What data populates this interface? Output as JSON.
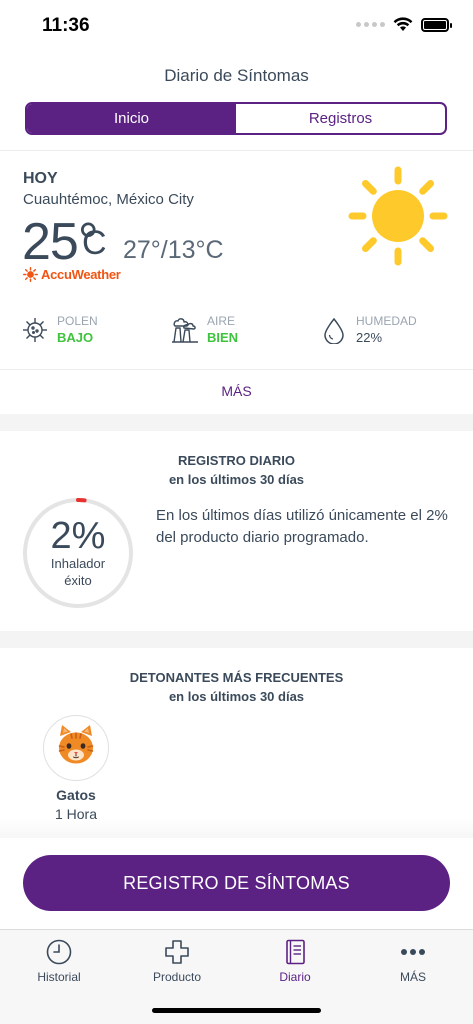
{
  "status_bar": {
    "time": "11:36"
  },
  "header": {
    "title": "Diario de Síntomas"
  },
  "segments": [
    {
      "label": "Inicio",
      "active": true
    },
    {
      "label": "Registros",
      "active": false
    }
  ],
  "weather": {
    "day": "HOY",
    "location": "Cuauhtémoc, México City",
    "temperature": "25°",
    "unit": "C",
    "range": "27°/13°C",
    "provider": "AccuWeather",
    "icon": "sun-icon",
    "metrics": [
      {
        "label": "POLEN",
        "value": "BAJO",
        "icon": "pollen-icon",
        "status_color": "#3fc33f"
      },
      {
        "label": "AIRE",
        "value": "BIEN",
        "icon": "air-quality-icon",
        "status_color": "#3fc33f"
      },
      {
        "label": "HUMEDAD",
        "value": "22%",
        "icon": "water-drop-icon"
      }
    ],
    "more_label": "MÁS"
  },
  "daily_log": {
    "title": "REGISTRO DIARIO",
    "subtitle": "en los últimos 30 días",
    "percent_text": "2%",
    "percent_value": 2,
    "ring_label_1": "Inhalador",
    "ring_label_2": "éxito",
    "description": "En los últimos días utilizó únicamente el 2% del producto diario programado."
  },
  "triggers": {
    "title": "DETONANTES MÁS FRECUENTES",
    "subtitle": "en los últimos 30 días",
    "items": [
      {
        "name": "Gatos",
        "duration": "1 Hora",
        "icon": "cat-icon"
      }
    ]
  },
  "cta": {
    "label": "REGISTRO DE SÍNTOMAS"
  },
  "tabbar": {
    "items": [
      {
        "label": "Historial",
        "icon": "clock-icon",
        "active": false
      },
      {
        "label": "Producto",
        "icon": "medical-cross-icon",
        "active": false
      },
      {
        "label": "Diario",
        "icon": "journal-icon",
        "active": true
      },
      {
        "label": "MÁS",
        "icon": "more-dots-icon",
        "active": false
      }
    ]
  },
  "colors": {
    "primary": "#5b2283",
    "text": "#3b4a5a",
    "muted": "#9aa5b1",
    "good": "#3fc33f",
    "sun": "#fdc92b",
    "accuweather": "#f05514",
    "ring_track": "#e4e4e4",
    "ring_progress": "#e8322f"
  }
}
